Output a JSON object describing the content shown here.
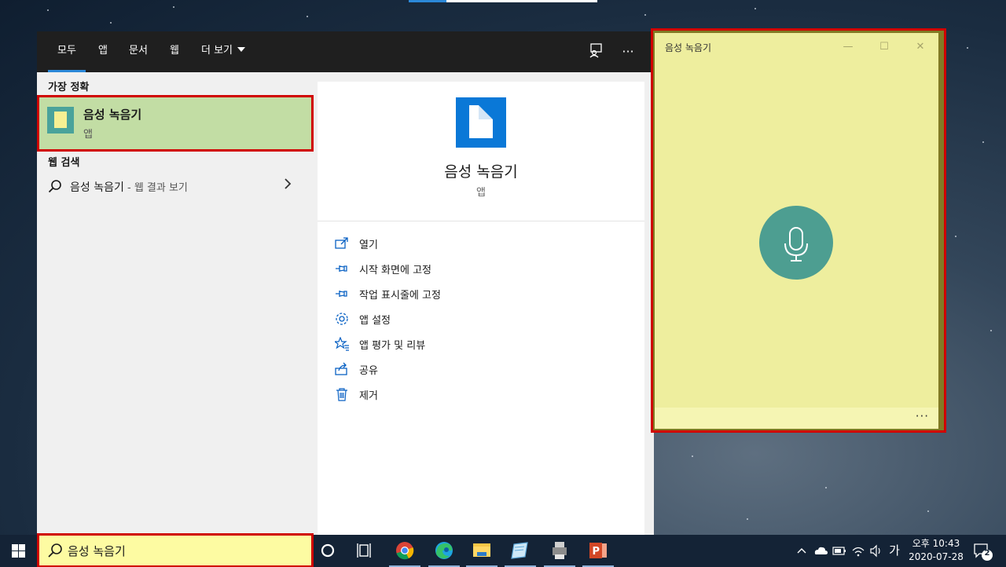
{
  "search": {
    "tabs": [
      {
        "label": "모두",
        "active": true
      },
      {
        "label": "앱"
      },
      {
        "label": "문서"
      },
      {
        "label": "웹"
      },
      {
        "label": "더 보기"
      }
    ],
    "feedback_icon": "feedback-icon",
    "more_icon": "ellipsis-icon",
    "best_match_label": "가장 정확",
    "best_match": {
      "title": "음성 녹음기",
      "subtitle": "앱",
      "icon": "voice-recorder-app-icon"
    },
    "web_search_label": "웹 검색",
    "web_result": {
      "query": "음성 녹음기",
      "suffix": " - 웹 결과 보기"
    },
    "detail": {
      "title": "음성 녹음기",
      "subtitle": "앱",
      "actions": [
        {
          "label": "열기",
          "icon": "open-icon"
        },
        {
          "label": "시작 화면에 고정",
          "icon": "pin-icon"
        },
        {
          "label": "작업 표시줄에 고정",
          "icon": "pin-icon"
        },
        {
          "label": "앱 설정",
          "icon": "gear-icon"
        },
        {
          "label": "앱 평가 및 리뷰",
          "icon": "star-rate-icon"
        },
        {
          "label": "공유",
          "icon": "share-icon"
        },
        {
          "label": "제거",
          "icon": "trash-icon"
        }
      ]
    }
  },
  "recorder": {
    "title": "음성 녹음기",
    "window_buttons": {
      "minimize": "—",
      "maximize": "☐",
      "close": "✕"
    },
    "more": "···",
    "bg_color": "#eeee9e",
    "mic_color": "#4d9e91"
  },
  "taskbar": {
    "search_value": "음성 녹음기",
    "apps": [
      "cortana-icon",
      "task-view-icon",
      "chrome-icon",
      "edge-icon",
      "file-explorer-icon",
      "notepad-icon",
      "printer-icon",
      "powerpoint-icon"
    ],
    "tray": {
      "ime": "가",
      "time": "오후 10:43",
      "date": "2020-07-28",
      "notifications": "2"
    }
  },
  "colors": {
    "accent": "#2b88d8",
    "highlight": "#c2dda4",
    "annotation": "#d00000"
  }
}
